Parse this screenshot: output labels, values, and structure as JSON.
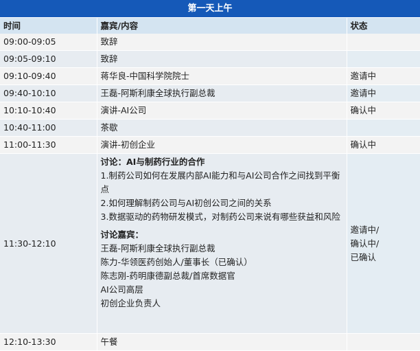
{
  "title": "第一天上午",
  "headers": {
    "time": "时间",
    "content": "嘉宾/内容",
    "status": "状态"
  },
  "rows": [
    {
      "time": "09:00-09:05",
      "content": "致辞",
      "status": ""
    },
    {
      "time": "09:05-09:10",
      "content": "致辞",
      "status": ""
    },
    {
      "time": "09:10-09:40",
      "content": "蒋华良-中国科学院院士",
      "status": "邀请中"
    },
    {
      "time": "09:40-10:10",
      "content": "王磊-阿斯利康全球执行副总裁",
      "status": "邀请中"
    },
    {
      "time": "10:10-10:40",
      "content": "演讲-AI公司",
      "status": "确认中"
    },
    {
      "time": "10:40-11:00",
      "content": "茶歇",
      "status": ""
    },
    {
      "time": "11:00-11:30",
      "content": "演讲-初创企业",
      "status": "确认中"
    }
  ],
  "panel": {
    "time": "11:30-12:10",
    "discussion_title": "讨论：AI与制药行业的合作",
    "questions": [
      "1.制药公司如何在发展内部AI能力和与AI公司合作之间找到平衡点",
      "2.如何理解制药公司与AI初创公司之间的关系",
      "3.数据驱动的药物研发模式，对制药公司来说有哪些获益和风险"
    ],
    "guests_title": "讨论嘉宾：",
    "guests": [
      "王磊-阿斯利康全球执行副总裁",
      "陈力-华领医药创始人/董事长（已确认）",
      "陈志刚-药明康德副总裁/首席数据官",
      "AI公司高层",
      "初创企业负责人"
    ],
    "status": [
      "邀请中/",
      "确认中/",
      "已确认"
    ]
  },
  "last_row": {
    "time": "12:10-13:30",
    "content": "午餐",
    "status": ""
  }
}
